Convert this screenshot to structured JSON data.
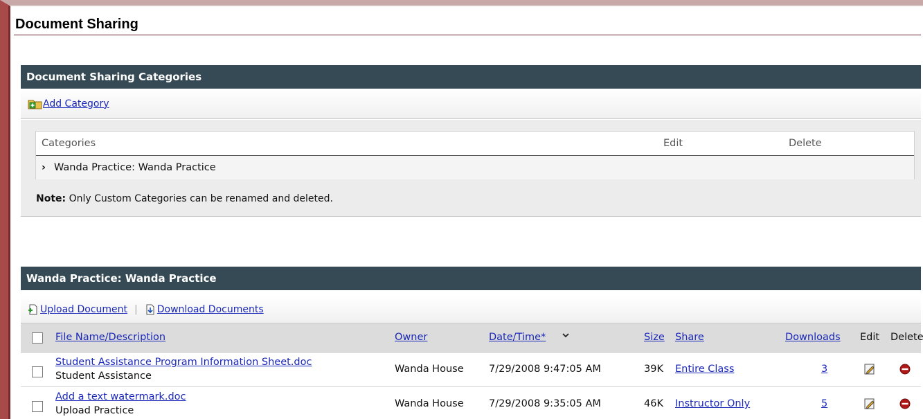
{
  "page": {
    "title": "Document Sharing"
  },
  "categories_section": {
    "header": "Document Sharing Categories",
    "add_category_label": "Add Category",
    "columns": {
      "categories": "Categories",
      "edit": "Edit",
      "delete": "Delete"
    },
    "rows": [
      {
        "name": "Wanda Practice: Wanda Practice"
      }
    ],
    "note_bold": "Note:",
    "note_text": " Only Custom Categories can be renamed and deleted."
  },
  "folder_section": {
    "header": "Wanda Practice: Wanda Practice",
    "upload_label": "Upload Document",
    "separator": "|",
    "download_label": "Download Documents",
    "columns": {
      "file": "File Name/Description",
      "owner": "Owner",
      "date": "Date/Time*",
      "size": "Size",
      "share": "Share",
      "downloads": "Downloads",
      "edit": "Edit",
      "delete": "Delete"
    },
    "files": [
      {
        "name": "Student Assistance Program Information Sheet.doc",
        "description": "Student Assistance",
        "owner": "Wanda House",
        "datetime": "7/29/2008 9:47:05 AM",
        "size": "39K",
        "share": "Entire Class",
        "downloads": "3"
      },
      {
        "name": "Add a text watermark.doc",
        "description": "Upload Practice",
        "owner": "Wanda House",
        "datetime": "7/29/2008 9:35:05 AM",
        "size": "46K",
        "share": "Instructor Only",
        "downloads": "5"
      }
    ]
  },
  "colors": {
    "section_header_bg": "#354a54",
    "link": "#1a28b8",
    "frame_border": "#a84a4a",
    "delete_icon": "#b01818"
  }
}
